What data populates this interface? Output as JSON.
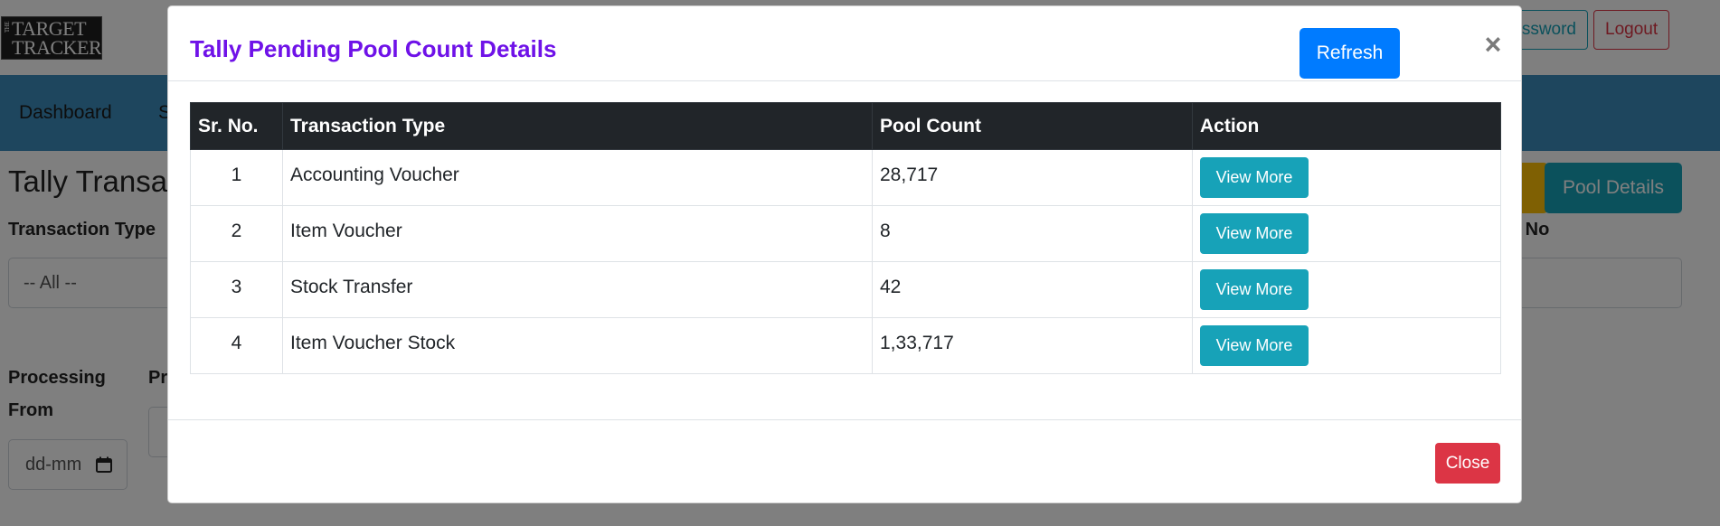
{
  "app": {
    "logo_the": "THE",
    "logo_line1": "TARGET",
    "logo_line2": "TRACKER",
    "password_button": "ssword",
    "logout_button": "Logout"
  },
  "nav": {
    "items": [
      {
        "label": "Dashboard"
      },
      {
        "label": "S"
      }
    ]
  },
  "page": {
    "title": "Tally Transac",
    "transaction_type_label": "Transaction Type",
    "transaction_type_value": "-- All --",
    "bill_no_label": "ll No",
    "processing_from_label_1": "Processing",
    "processing_from_label_2": "From",
    "processing_to_label": "Pr",
    "date_placeholder": "dd-mm",
    "pool_details_button": "Pool Details"
  },
  "modal": {
    "title": "Tally Pending Pool Count Details",
    "refresh_button": "Refresh",
    "close_x": "×",
    "close_button": "Close",
    "columns": [
      "Sr. No.",
      "Transaction Type",
      "Pool Count",
      "Action"
    ],
    "rows": [
      {
        "sr": "1",
        "type": "Accounting Voucher",
        "count": "28,717",
        "action": "View More"
      },
      {
        "sr": "2",
        "type": "Item Voucher",
        "count": "8",
        "action": "View More"
      },
      {
        "sr": "3",
        "type": "Stock Transfer",
        "count": "42",
        "action": "View More"
      },
      {
        "sr": "4",
        "type": "Item Voucher Stock",
        "count": "1,33,717",
        "action": "View More"
      }
    ]
  },
  "colors": {
    "title": "#6f12e8",
    "primary": "#007bff",
    "info": "#17a2b8",
    "danger": "#dc3545",
    "navbar": "#3c8dbc",
    "table_header": "#212529"
  }
}
